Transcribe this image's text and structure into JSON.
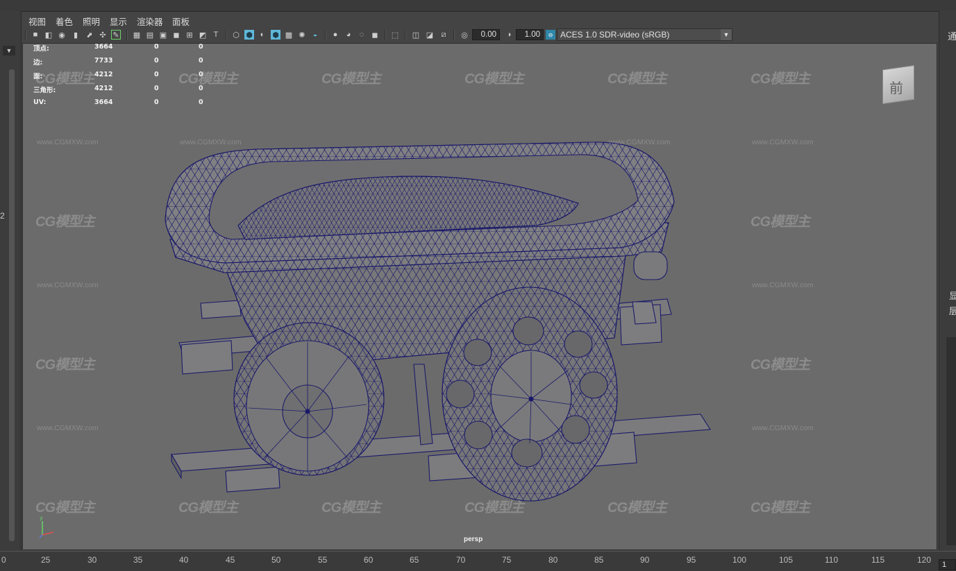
{
  "menu": [
    "视图",
    "着色",
    "照明",
    "显示",
    "渲染器",
    "面板"
  ],
  "toolbar": {
    "exposure_value": "0.00",
    "gamma_value": "1.00",
    "color_management": "ACES 1.0 SDR-video (sRGB)",
    "icons": [
      "camera-select-icon",
      "camera-attr-icon",
      "bookmark-icon",
      "image-plane-icon",
      "2d-pan-icon",
      "grease-pencil-icon",
      "grid-icon",
      "film-gate-icon",
      "resolution-gate-icon",
      "gate-mask-icon",
      "field-chart-icon",
      "safe-action-icon",
      "safe-title-icon",
      "wireframe-icon",
      "smooth-shade-icon",
      "default-material-icon",
      "wireframe-on-shaded-icon",
      "textured-icon",
      "use-lights-icon",
      "shadows-icon",
      "screen-space-ao-icon",
      "motion-blur-icon",
      "anti-aliasing-icon",
      "depth-of-field-icon",
      "isolate-select-icon",
      "xray-icon",
      "xray-joints-icon",
      "xray-active-icon",
      "backface-culling-icon",
      "exposure-icon",
      "gamma-icon",
      "view-transform-icon"
    ]
  },
  "hud": [
    {
      "label": "顶点:",
      "v1": "3664",
      "v2": "0",
      "v3": "0"
    },
    {
      "label": "边:",
      "v1": "7733",
      "v2": "0",
      "v3": "0"
    },
    {
      "label": "面:",
      "v1": "4212",
      "v2": "0",
      "v3": "0"
    },
    {
      "label": "三角形:",
      "v1": "4212",
      "v2": "0",
      "v3": "0"
    },
    {
      "label": "UV:",
      "v1": "3664",
      "v2": "0",
      "v3": "0"
    }
  ],
  "viewcube_label": "前",
  "camera_name": "persp",
  "watermark": {
    "logo": "CG模型主",
    "url": "www.CGMXW.com"
  },
  "timeline_ticks": [
    "0",
    "25",
    "30",
    "35",
    "40",
    "45",
    "50",
    "55",
    "60",
    "65",
    "70",
    "75",
    "80",
    "85",
    "90",
    "95",
    "100",
    "105",
    "110",
    "115",
    "120"
  ],
  "timeline_current": "1",
  "left_panel_number": "2",
  "right_panel_text": [
    "通",
    "显",
    "层"
  ],
  "colors": {
    "viewport_bg": "#6b6b6b",
    "wire": "#1b1a6a",
    "mesh_face": "#7a7a7c",
    "accent": "#5fb8d9"
  }
}
